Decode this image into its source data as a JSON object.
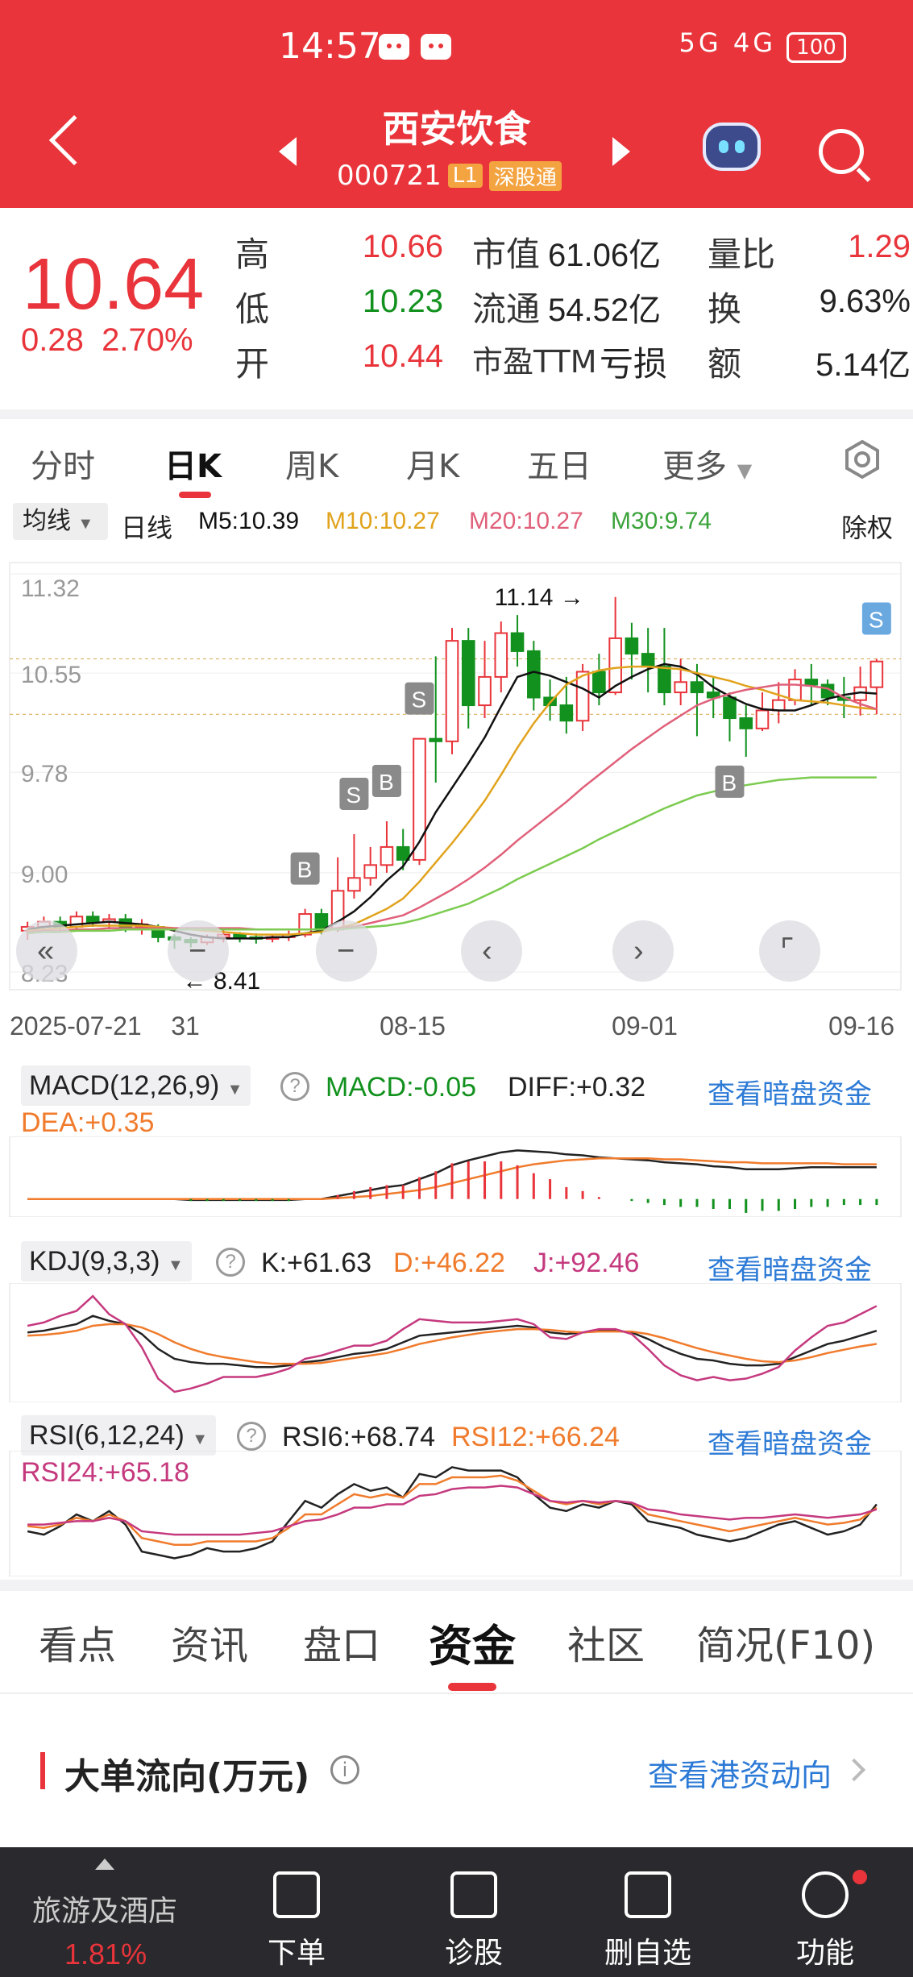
{
  "status_bar": {
    "time": "14:57",
    "signal_text": "5G 4G",
    "battery": "100"
  },
  "header": {
    "stock_name": "西安饮食",
    "stock_code": "000721",
    "level_tag": "L1",
    "connect_tag": "深股通"
  },
  "quote": {
    "price": "10.64",
    "change": "0.28",
    "change_pct": "2.70%",
    "high_label": "高",
    "high": "10.66",
    "low_label": "低",
    "low": "10.23",
    "open_label": "开",
    "open": "10.44",
    "mcap_label": "市值",
    "mcap": "61.06亿",
    "float_label": "流通",
    "float": "54.52亿",
    "pe_label": "市盈TTM",
    "pe": "亏损",
    "vol_ratio_label": "量比",
    "vol_ratio": "1.29",
    "turnover_label": "换",
    "turnover": "9.63%",
    "amount_label": "额",
    "amount": "5.14亿"
  },
  "period_tabs": [
    "分时",
    "日K",
    "周K",
    "月K",
    "五日",
    "更多"
  ],
  "active_period": "日K",
  "ma_row": {
    "select": "均线",
    "type": "日线",
    "m5": "M5:10.39",
    "m10": "M10:10.27",
    "m20": "M20:10.27",
    "m30": "M30:9.74",
    "adjust": "除权"
  },
  "colors": {
    "up": "#e8343a",
    "down": "#12911e",
    "m5": "#111111",
    "m10": "#e1a31d",
    "m20": "#e0607a",
    "m30": "#7ccb50",
    "link": "#2c7ad6"
  },
  "chart_data": [
    {
      "type": "candlestick",
      "title": "",
      "y_ticks": [
        "11.32",
        "10.55",
        "9.78",
        "9.00",
        "8.23"
      ],
      "ylim": [
        8.23,
        11.32
      ],
      "x_ticks": [
        "2025-07-21",
        "31",
        "08-15",
        "09-01",
        "09-16"
      ],
      "annotations": {
        "high_label": "11.14",
        "low_label": "8.41"
      },
      "candles": [
        [
          8.55,
          8.58,
          8.48,
          8.62
        ],
        [
          8.58,
          8.62,
          8.55,
          8.66
        ],
        [
          8.62,
          8.58,
          8.54,
          8.66
        ],
        [
          8.58,
          8.66,
          8.56,
          8.7
        ],
        [
          8.66,
          8.62,
          8.58,
          8.7
        ],
        [
          8.62,
          8.64,
          8.56,
          8.68
        ],
        [
          8.64,
          8.58,
          8.54,
          8.68
        ],
        [
          8.58,
          8.6,
          8.52,
          8.64
        ],
        [
          8.58,
          8.5,
          8.46,
          8.6
        ],
        [
          8.5,
          8.48,
          8.41,
          8.52
        ],
        [
          8.48,
          8.46,
          8.42,
          8.5
        ],
        [
          8.46,
          8.5,
          8.44,
          8.52
        ],
        [
          8.5,
          8.52,
          8.46,
          8.56
        ],
        [
          8.52,
          8.5,
          8.46,
          8.54
        ],
        [
          8.5,
          8.49,
          8.45,
          8.53
        ],
        [
          8.49,
          8.5,
          8.46,
          8.52
        ],
        [
          8.5,
          8.52,
          8.47,
          8.55
        ],
        [
          8.52,
          8.68,
          8.5,
          8.72
        ],
        [
          8.68,
          8.56,
          8.52,
          8.72
        ],
        [
          8.56,
          8.86,
          8.54,
          9.12
        ],
        [
          8.86,
          8.96,
          8.8,
          9.3
        ],
        [
          8.96,
          9.06,
          8.9,
          9.2
        ],
        [
          9.06,
          9.2,
          9.0,
          9.4
        ],
        [
          9.2,
          9.1,
          9.02,
          9.34
        ],
        [
          9.1,
          10.04,
          9.06,
          10.04
        ],
        [
          10.04,
          10.02,
          9.7,
          10.68
        ],
        [
          10.02,
          10.8,
          9.92,
          10.9
        ],
        [
          10.8,
          10.3,
          10.12,
          10.9
        ],
        [
          10.3,
          10.52,
          10.2,
          10.8
        ],
        [
          10.52,
          10.86,
          10.4,
          10.95
        ],
        [
          10.86,
          10.72,
          10.6,
          11.0
        ],
        [
          10.72,
          10.36,
          10.26,
          10.8
        ],
        [
          10.36,
          10.3,
          10.18,
          10.5
        ],
        [
          10.3,
          10.18,
          10.08,
          10.52
        ],
        [
          10.18,
          10.56,
          10.1,
          10.62
        ],
        [
          10.56,
          10.4,
          10.3,
          10.7
        ],
        [
          10.4,
          10.82,
          10.38,
          11.14
        ],
        [
          10.82,
          10.7,
          10.5,
          10.94
        ],
        [
          10.7,
          10.6,
          10.4,
          10.9
        ],
        [
          10.6,
          10.4,
          10.3,
          10.9
        ],
        [
          10.4,
          10.48,
          10.3,
          10.66
        ],
        [
          10.48,
          10.4,
          10.06,
          10.62
        ],
        [
          10.4,
          10.36,
          10.2,
          10.52
        ],
        [
          10.36,
          10.2,
          10.02,
          10.4
        ],
        [
          10.2,
          10.12,
          9.9,
          10.3
        ],
        [
          10.12,
          10.26,
          10.1,
          10.4
        ],
        [
          10.26,
          10.34,
          10.16,
          10.48
        ],
        [
          10.34,
          10.5,
          10.3,
          10.58
        ],
        [
          10.5,
          10.46,
          10.3,
          10.62
        ],
        [
          10.46,
          10.36,
          10.3,
          10.5
        ],
        [
          10.36,
          10.34,
          10.2,
          10.52
        ],
        [
          10.34,
          10.44,
          10.22,
          10.6
        ],
        [
          10.44,
          10.64,
          10.23,
          10.66
        ]
      ],
      "candle_format": [
        "open",
        "close",
        "low",
        "high"
      ],
      "ma5": [
        8.56,
        8.58,
        8.59,
        8.6,
        8.61,
        8.62,
        8.61,
        8.6,
        8.58,
        8.55,
        8.52,
        8.5,
        8.49,
        8.49,
        8.49,
        8.5,
        8.5,
        8.53,
        8.55,
        8.62,
        8.7,
        8.81,
        8.94,
        9.05,
        9.24,
        9.47,
        9.66,
        9.85,
        10.05,
        10.29,
        10.52,
        10.56,
        10.53,
        10.48,
        10.43,
        10.36,
        10.45,
        10.52,
        10.58,
        10.62,
        10.6,
        10.54,
        10.44,
        10.37,
        10.31,
        10.27,
        10.26,
        10.26,
        10.3,
        10.35,
        10.38,
        10.4,
        10.39
      ],
      "ma10": [
        8.55,
        8.56,
        8.57,
        8.58,
        8.59,
        8.59,
        8.59,
        8.59,
        8.58,
        8.57,
        8.56,
        8.55,
        8.54,
        8.53,
        8.52,
        8.52,
        8.52,
        8.53,
        8.54,
        8.57,
        8.6,
        8.66,
        8.72,
        8.8,
        8.93,
        9.08,
        9.23,
        9.39,
        9.56,
        9.76,
        9.97,
        10.16,
        10.32,
        10.46,
        10.53,
        10.57,
        10.59,
        10.6,
        10.6,
        10.59,
        10.58,
        10.55,
        10.52,
        10.49,
        10.45,
        10.42,
        10.38,
        10.34,
        10.33,
        10.32,
        10.3,
        10.28,
        10.27
      ],
      "ma20": [
        8.54,
        8.55,
        8.55,
        8.56,
        8.56,
        8.57,
        8.57,
        8.57,
        8.57,
        8.57,
        8.57,
        8.57,
        8.57,
        8.57,
        8.56,
        8.56,
        8.56,
        8.56,
        8.56,
        8.57,
        8.58,
        8.61,
        8.64,
        8.67,
        8.73,
        8.8,
        8.87,
        8.95,
        9.04,
        9.14,
        9.25,
        9.35,
        9.45,
        9.55,
        9.66,
        9.76,
        9.86,
        9.96,
        10.05,
        10.14,
        10.22,
        10.3,
        10.35,
        10.39,
        10.42,
        10.44,
        10.46,
        10.46,
        10.45,
        10.43,
        10.36,
        10.31,
        10.27
      ],
      "ma30": [
        8.53,
        8.54,
        8.54,
        8.55,
        8.55,
        8.55,
        8.56,
        8.56,
        8.56,
        8.56,
        8.56,
        8.56,
        8.56,
        8.56,
        8.56,
        8.56,
        8.56,
        8.56,
        8.56,
        8.56,
        8.57,
        8.58,
        8.59,
        8.61,
        8.64,
        8.68,
        8.72,
        8.76,
        8.82,
        8.88,
        8.95,
        9.01,
        9.07,
        9.13,
        9.19,
        9.26,
        9.32,
        9.38,
        9.44,
        9.5,
        9.55,
        9.6,
        9.63,
        9.66,
        9.68,
        9.7,
        9.72,
        9.73,
        9.74,
        9.74,
        9.74,
        9.74,
        9.74
      ]
    },
    {
      "type": "line",
      "title": "MACD(12,26,9)",
      "series": [
        {
          "name": "MACD",
          "label": "MACD:-0.05"
        },
        {
          "name": "DIFF",
          "label": "DIFF:+0.32",
          "values": [
            0.0,
            0.0,
            0.0,
            0.0,
            0.0,
            0.0,
            0.0,
            0.0,
            0.0,
            0.0,
            -0.01,
            -0.01,
            -0.01,
            -0.01,
            -0.01,
            -0.01,
            -0.01,
            0.0,
            0.0,
            0.03,
            0.06,
            0.09,
            0.12,
            0.14,
            0.2,
            0.26,
            0.34,
            0.39,
            0.43,
            0.47,
            0.49,
            0.48,
            0.47,
            0.45,
            0.44,
            0.42,
            0.41,
            0.4,
            0.39,
            0.37,
            0.36,
            0.35,
            0.33,
            0.32,
            0.3,
            0.3,
            0.3,
            0.31,
            0.32,
            0.32,
            0.32,
            0.32,
            0.32
          ]
        },
        {
          "name": "DEA",
          "label": "DEA:+0.35",
          "values": [
            0.0,
            0.0,
            0.0,
            0.0,
            0.0,
            0.0,
            0.0,
            0.0,
            0.0,
            0.0,
            0.0,
            0.0,
            0.0,
            0.0,
            0.0,
            0.0,
            0.0,
            0.0,
            0.0,
            0.01,
            0.02,
            0.03,
            0.05,
            0.07,
            0.09,
            0.12,
            0.16,
            0.2,
            0.24,
            0.28,
            0.32,
            0.35,
            0.37,
            0.39,
            0.4,
            0.41,
            0.41,
            0.41,
            0.41,
            0.4,
            0.4,
            0.39,
            0.38,
            0.37,
            0.37,
            0.36,
            0.36,
            0.36,
            0.36,
            0.36,
            0.35,
            0.35,
            0.35
          ]
        }
      ]
    },
    {
      "type": "line",
      "title": "KDJ(9,3,3)",
      "series": [
        {
          "name": "K",
          "label": "K:+61.63",
          "values": [
            60,
            62,
            66,
            70,
            80,
            74,
            70,
            58,
            40,
            28,
            24,
            22,
            22,
            20,
            18,
            18,
            20,
            24,
            26,
            30,
            34,
            36,
            40,
            48,
            56,
            58,
            60,
            62,
            64,
            66,
            68,
            66,
            60,
            58,
            60,
            62,
            62,
            60,
            52,
            42,
            34,
            28,
            26,
            22,
            20,
            20,
            22,
            30,
            38,
            46,
            50,
            56,
            62
          ]
        },
        {
          "name": "D",
          "label": "D:+46.22",
          "values": [
            56,
            57,
            59,
            62,
            68,
            70,
            70,
            66,
            58,
            48,
            40,
            34,
            30,
            27,
            24,
            22,
            22,
            22,
            23,
            26,
            29,
            32,
            35,
            40,
            46,
            50,
            54,
            57,
            60,
            62,
            64,
            64,
            63,
            61,
            60,
            61,
            61,
            61,
            58,
            53,
            47,
            41,
            36,
            32,
            28,
            25,
            24,
            26,
            30,
            35,
            39,
            43,
            46
          ]
        },
        {
          "name": "J",
          "label": "J:+92.46",
          "values": [
            68,
            72,
            80,
            86,
            104,
            82,
            70,
            42,
            4,
            -12,
            -8,
            -2,
            6,
            6,
            6,
            10,
            16,
            28,
            32,
            38,
            44,
            44,
            50,
            64,
            76,
            74,
            72,
            72,
            72,
            74,
            76,
            70,
            54,
            52,
            60,
            64,
            64,
            58,
            40,
            20,
            8,
            2,
            6,
            2,
            4,
            10,
            18,
            38,
            54,
            68,
            72,
            82,
            92
          ]
        }
      ]
    },
    {
      "type": "line",
      "title": "RSI(6,12,24)",
      "series": [
        {
          "name": "RSI6",
          "label": "RSI6:+68.74",
          "values": [
            52,
            50,
            55,
            62,
            58,
            64,
            56,
            40,
            38,
            36,
            38,
            42,
            40,
            40,
            42,
            46,
            58,
            70,
            66,
            74,
            80,
            76,
            78,
            72,
            86,
            84,
            90,
            88,
            88,
            88,
            84,
            74,
            66,
            64,
            68,
            66,
            70,
            68,
            58,
            56,
            54,
            50,
            48,
            46,
            48,
            52,
            56,
            58,
            54,
            50,
            52,
            56,
            68
          ]
        },
        {
          "name": "RSI12",
          "label": "RSI12:+66.24",
          "values": [
            55,
            54,
            56,
            60,
            58,
            62,
            58,
            48,
            46,
            44,
            44,
            46,
            46,
            46,
            46,
            48,
            54,
            62,
            62,
            68,
            74,
            72,
            74,
            72,
            80,
            80,
            84,
            84,
            84,
            85,
            82,
            76,
            70,
            68,
            70,
            68,
            70,
            69,
            62,
            60,
            58,
            56,
            54,
            52,
            54,
            56,
            58,
            60,
            58,
            56,
            57,
            59,
            66
          ]
        },
        {
          "name": "RSI24",
          "label": "RSI24:+65.18",
          "values": [
            56,
            56,
            57,
            58,
            58,
            60,
            58,
            52,
            51,
            50,
            50,
            50,
            50,
            50,
            51,
            52,
            55,
            58,
            59,
            62,
            66,
            66,
            68,
            68,
            73,
            74,
            77,
            78,
            78,
            79,
            78,
            74,
            70,
            69,
            70,
            69,
            70,
            69,
            65,
            64,
            62,
            61,
            60,
            59,
            60,
            60,
            61,
            62,
            61,
            60,
            61,
            62,
            65
          ]
        }
      ]
    }
  ],
  "indicator_link": "查看暗盘资金",
  "section_tabs": [
    "看点",
    "资讯",
    "盘口",
    "资金",
    "社区",
    "简况(F10)"
  ],
  "active_section": "资金",
  "flow": {
    "title": "大单流向(万元)",
    "link": "查看港资动向"
  },
  "bottom_bar": {
    "sector_name": "旅游及酒店",
    "sector_pct": "1.81%",
    "items": [
      "下单",
      "诊股",
      "删自选",
      "功能"
    ]
  }
}
